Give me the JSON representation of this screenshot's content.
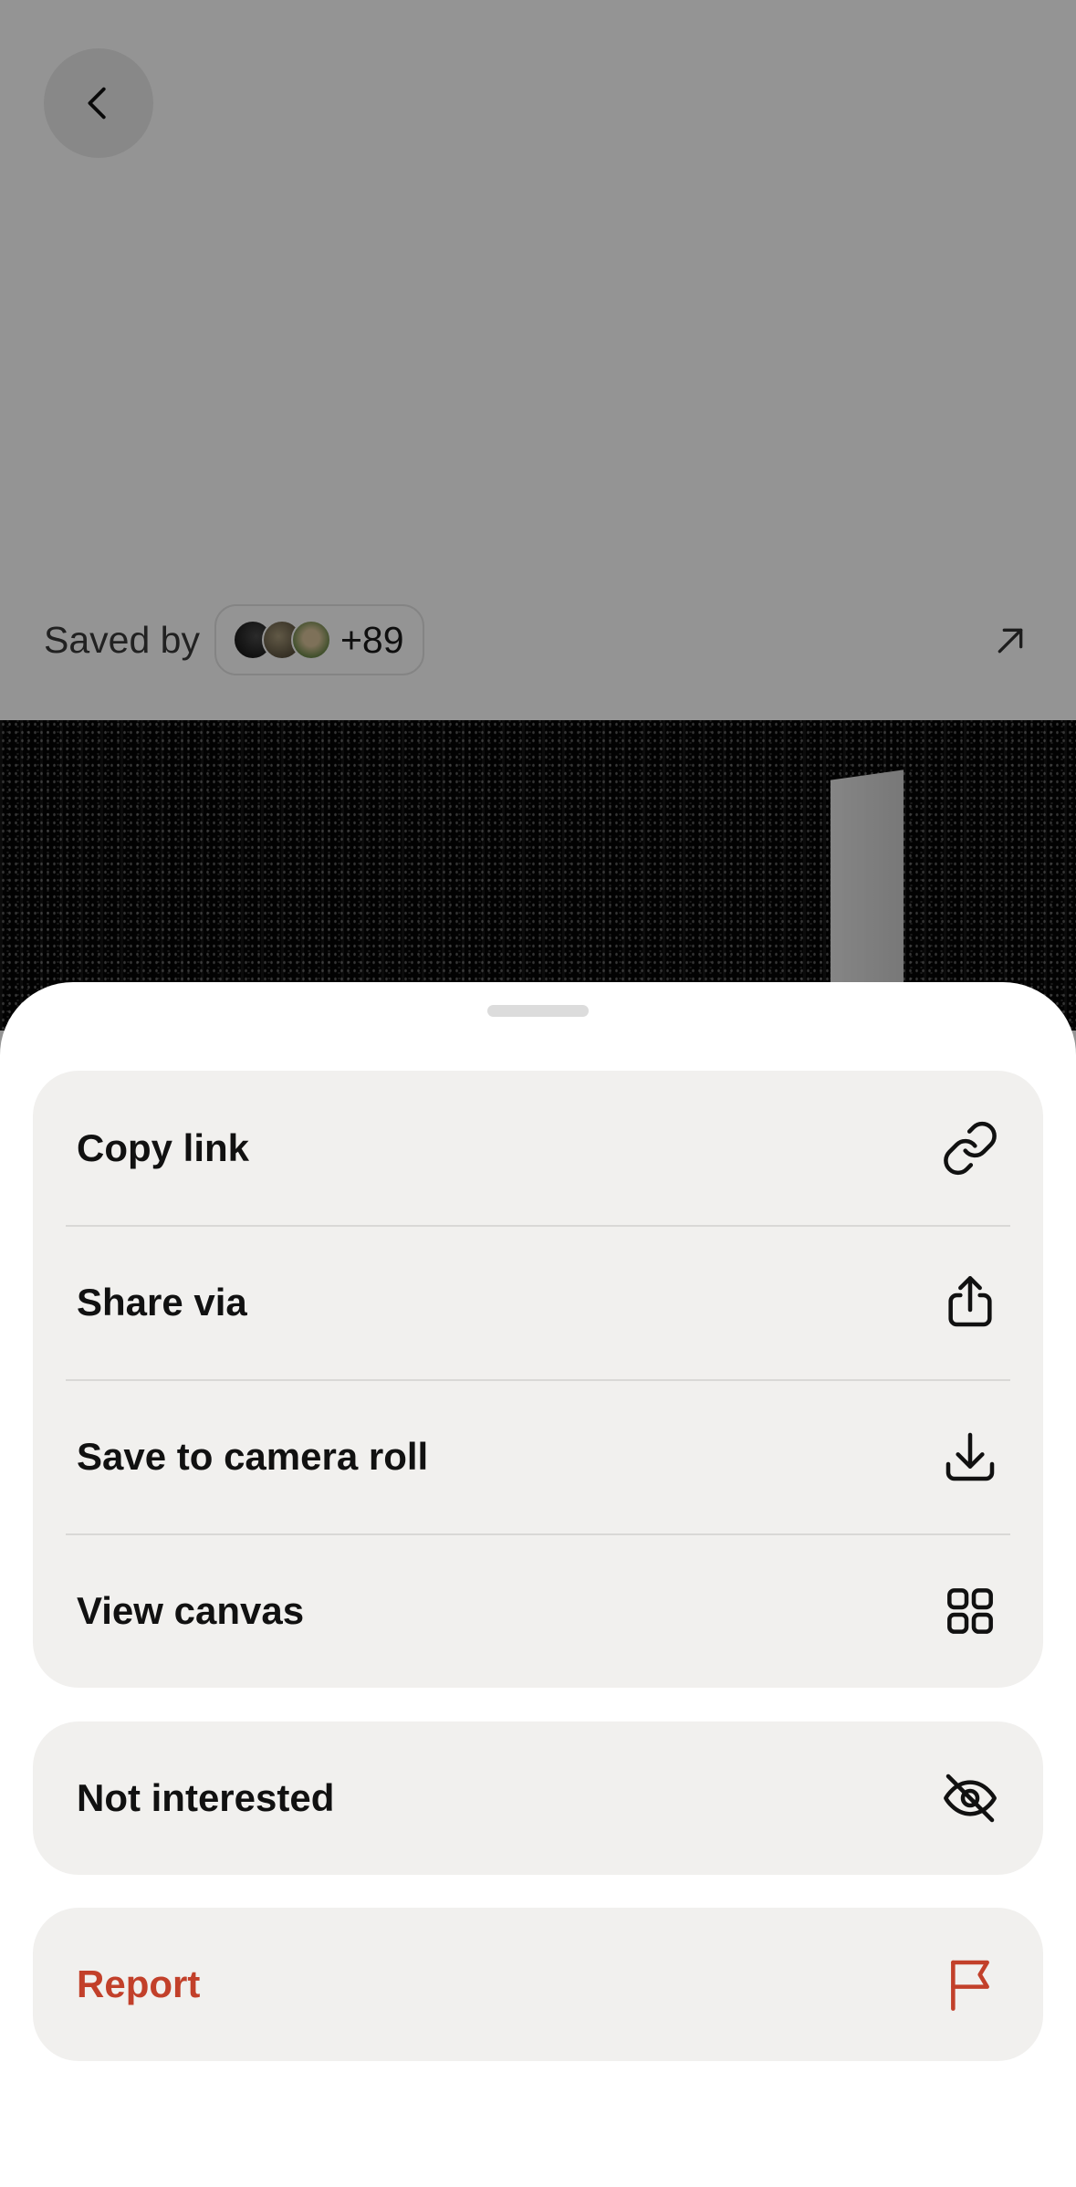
{
  "header": {
    "back_icon": "chevron-left-icon"
  },
  "saved_by": {
    "label": "Saved by",
    "count": "+89",
    "open_icon": "arrow-up-right-icon"
  },
  "sheet": {
    "main_actions": [
      {
        "label": "Copy link",
        "icon": "link-icon"
      },
      {
        "label": "Share via",
        "icon": "share-icon"
      },
      {
        "label": "Save to camera roll",
        "icon": "download-icon"
      },
      {
        "label": "View canvas",
        "icon": "grid-icon"
      }
    ],
    "not_interested": {
      "label": "Not interested",
      "icon": "eye-off-icon"
    },
    "report": {
      "label": "Report",
      "icon": "flag-icon",
      "color": "#c2402a"
    }
  },
  "colors": {
    "sheet_background": "#ffffff",
    "group_background": "#f1f0ee",
    "danger": "#c2402a"
  }
}
